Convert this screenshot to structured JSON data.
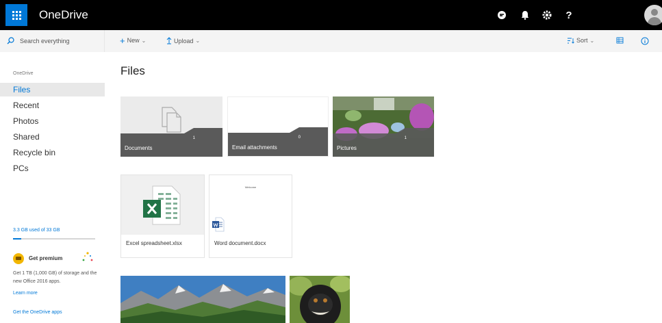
{
  "header": {
    "app_name": "OneDrive",
    "icons": [
      "skype-icon",
      "bell-icon",
      "gear-icon",
      "help-icon",
      "avatar"
    ],
    "help_label": "?"
  },
  "search": {
    "placeholder": "Search everything"
  },
  "commands": {
    "new_label": "New",
    "upload_label": "Upload",
    "sort_label": "Sort"
  },
  "nav": {
    "section_label": "OneDrive",
    "items": [
      "Files",
      "Recent",
      "Photos",
      "Shared",
      "Recycle bin",
      "PCs"
    ],
    "active": "Files"
  },
  "storage": {
    "text": "3.3 GB used of 33 GB",
    "used_fraction": 0.1
  },
  "premium": {
    "title": "Get premium",
    "description": "Get 1 TB (1,000 GB) of storage and the new Office 2016 apps.",
    "learn_more": "Learn more",
    "apps_link": "Get the OneDrive apps"
  },
  "main": {
    "title": "Files",
    "folders": [
      {
        "name": "Documents",
        "count": "1"
      },
      {
        "name": "Email attachments",
        "count": "0"
      },
      {
        "name": "Pictures",
        "count": "1"
      }
    ],
    "files": [
      {
        "name": "Excel spreadsheet.xlsx",
        "type": "excel"
      },
      {
        "name": "Word document.docx",
        "type": "word",
        "preview_text": "Welcome"
      }
    ]
  },
  "colors": {
    "accent": "#0078d7",
    "topbar": "#000000",
    "excel": "#217346",
    "word": "#2b579a"
  }
}
